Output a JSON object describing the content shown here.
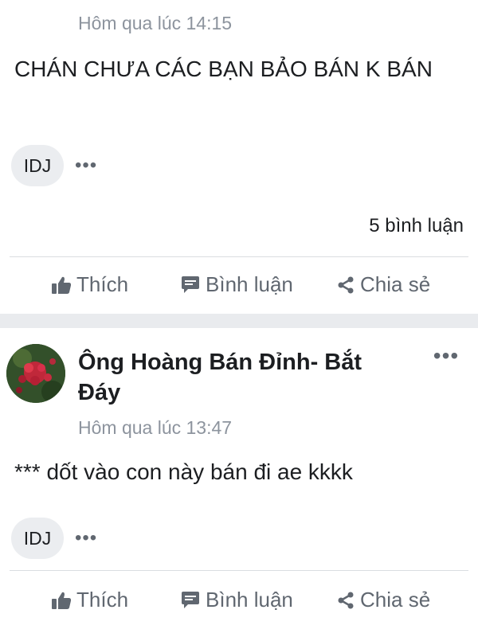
{
  "posts": [
    {
      "timestamp": "Hôm qua lúc 14:15",
      "body": "CHÁN CHƯA CÁC BẠN BẢO BÁN K BÁN",
      "reaction_label": "IDJ",
      "reaction_more": "•••",
      "comment_count": "5 bình luận",
      "actions": {
        "like": "Thích",
        "comment": "Bình luận",
        "share": "Chia sẻ"
      }
    },
    {
      "author": "Ông Hoàng Bán Đỉnh- Bắt Đáy",
      "more": "•••",
      "timestamp": "Hôm qua lúc 13:47",
      "body": "*** dốt vào con này bán đi ae kkkk",
      "reaction_label": "IDJ",
      "reaction_more": "•••",
      "actions": {
        "like": "Thích",
        "comment": "Bình luận",
        "share": "Chia sẻ"
      }
    }
  ],
  "colors": {
    "text": "#1c1e21",
    "muted": "#606770",
    "timestamp": "#8d949e",
    "separator": "#e9ebee",
    "pill": "#ebedf0"
  }
}
